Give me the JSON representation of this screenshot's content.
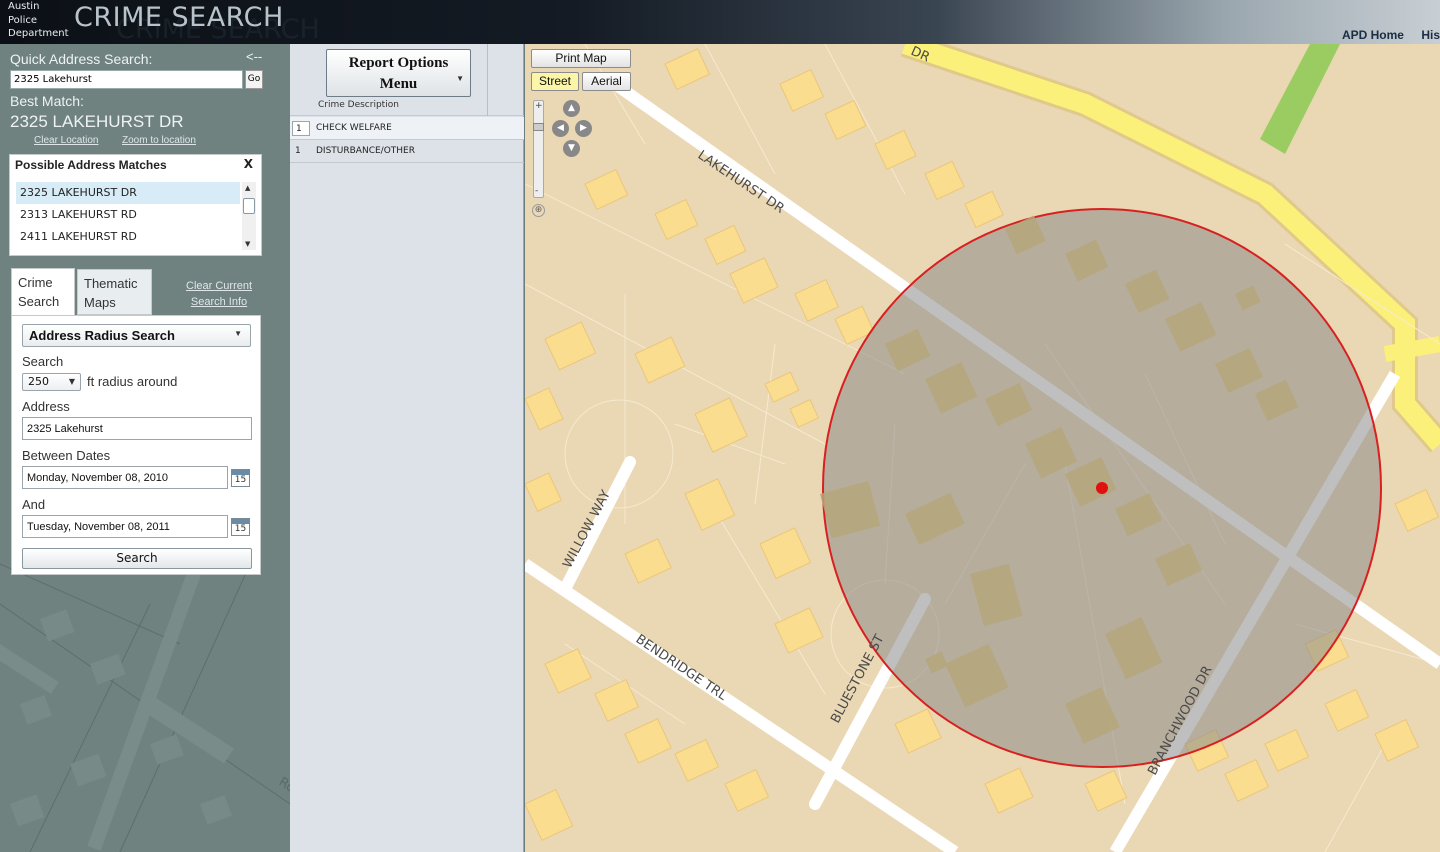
{
  "header": {
    "dept_lines": [
      "Austin",
      "Police",
      "Department"
    ],
    "title": "CRIME SEARCH",
    "nav_links": [
      "APD Home",
      "His"
    ]
  },
  "sidebar": {
    "quick_search_label": "Quick Address Search:",
    "back_arrow": "<--",
    "quick_search_value": "2325 Lakehurst",
    "go_label": "Go",
    "best_match_label": "Best Match:",
    "best_match_value": "2325 LAKEHURST DR",
    "clear_location": "Clear Location",
    "zoom_to_location": "Zoom to location",
    "possible_matches": {
      "title": "Possible Address Matches",
      "close": "X",
      "items": [
        "2325 LAKEHURST DR",
        "2313 LAKEHURST RD",
        "2411 LAKEHURST RD"
      ]
    },
    "tabs": [
      {
        "line1": "Crime",
        "line2": "Search"
      },
      {
        "line1": "Thematic",
        "line2": "Maps"
      }
    ],
    "clear_current": {
      "line1": "Clear Current",
      "line2": "Search Info"
    },
    "form": {
      "search_type": "Address Radius Search",
      "search_label": "Search",
      "radius_value": "250",
      "radius_suffix": "ft radius around",
      "address_label": "Address",
      "address_value": "2325 Lakehurst",
      "between_label": "Between Dates",
      "start_date": "Monday, November 08, 2010",
      "and_label": "And",
      "end_date": "Tuesday, November 08, 2011",
      "calendar_day": "15",
      "search_button": "Search"
    },
    "map_street_label": "Ro"
  },
  "results": {
    "report_options": {
      "line1": "Report Options",
      "line2": "Menu"
    },
    "column_header": "Crime Description",
    "rows": [
      {
        "count": "1",
        "description": "CHECK WELFARE"
      },
      {
        "count": "1",
        "description": "DISTURBANCE/OTHER"
      }
    ]
  },
  "map": {
    "print_label": "Print Map",
    "street_label": "Street",
    "aerial_label": "Aerial",
    "street_names": [
      "LAKEHURST DR",
      "WILLOW WAY",
      "BENDRIDGE TRL",
      "BLUESTONE ST",
      "BRANCHWOOD DR",
      "DR"
    ],
    "search_radius_ft": "250",
    "colors": {
      "land": "#ead7b3",
      "building": "#fbdd8f",
      "street": "#ffffff",
      "highway": "#fbf17a",
      "radius_fill": "#8a8a8a",
      "radius_stroke": "#d82020",
      "marker": "#e01010",
      "park": "#9bcc62"
    }
  }
}
